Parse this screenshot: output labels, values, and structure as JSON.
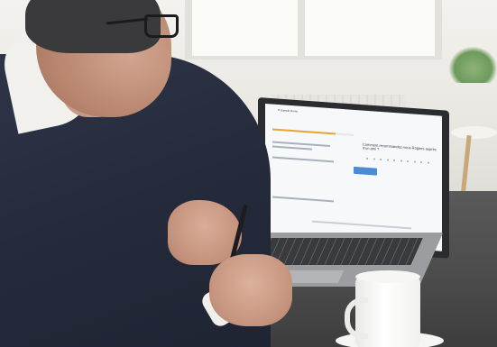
{
  "screen": {
    "brand": "Π Sample Home",
    "question": "Comment recommandez-vous Rogiers auprès d'un ami ?",
    "button_label": "",
    "progress": 0.78
  }
}
